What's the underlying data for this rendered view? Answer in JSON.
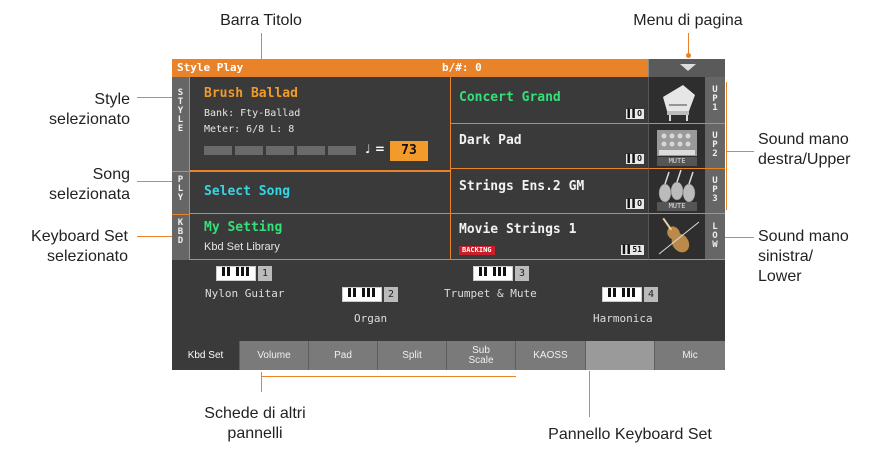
{
  "callouts": {
    "barra_titolo": "Barra Titolo",
    "menu_pagina": "Menu di pagina",
    "style_sel_1": "Style",
    "style_sel_2": "selezionato",
    "song_sel_1": "Song",
    "song_sel_2": "selezionata",
    "kbdset_sel_1": "Keyboard Set",
    "kbdset_sel_2": "selezionato",
    "upper_1": "Sound mano",
    "upper_2": "destra/Upper",
    "lower_1": "Sound mano",
    "lower_2": "sinistra/",
    "lower_3": "Lower",
    "schede_1": "Schede di altri",
    "schede_2": "pannelli",
    "pannello_kbd": "Pannello Keyboard Set"
  },
  "titlebar": {
    "mode": "Style Play",
    "key": "b/#: 0"
  },
  "side_tabs": {
    "style": [
      "S",
      "T",
      "Y",
      "L",
      "E"
    ],
    "play": [
      "P",
      "L",
      "Y"
    ],
    "kbd": [
      "K",
      "B",
      "D"
    ]
  },
  "style_panel": {
    "name": "Brush Ballad",
    "bank": "Bank: Fty-Ballad",
    "meter": "Meter: 6/8 L:  8",
    "tempo_symbol": "♩ =",
    "tempo": "73"
  },
  "song_panel": {
    "name": "Select Song"
  },
  "kbdset_panel": {
    "name": "My Setting",
    "library": "Kbd Set Library"
  },
  "sounds": [
    {
      "name": "Concert Grand",
      "mini": "▌▌O",
      "tab": [
        "U",
        "P",
        "1"
      ],
      "icon": "piano-icon",
      "mute": ""
    },
    {
      "name": "Dark Pad",
      "mini": "▌▌O",
      "tab": [
        "U",
        "P",
        "2"
      ],
      "icon": "synth-pad-icon",
      "mute": "MUTE"
    },
    {
      "name": "Strings Ens.2 GM",
      "mini": "▌▌O",
      "tab": [
        "U",
        "P",
        "3"
      ],
      "icon": "strings-icon",
      "mute": "MUTE"
    },
    {
      "name": "Movie Strings 1",
      "mini": "▌▌51",
      "tab": [
        "L",
        "O",
        "W"
      ],
      "icon": "violin-icon",
      "mute": "",
      "badge": "BACKING"
    }
  ],
  "keyboards": [
    {
      "num": "1",
      "name": "Nylon Guitar"
    },
    {
      "num": "2",
      "name": "Organ"
    },
    {
      "num": "3",
      "name": "Trumpet & Mute"
    },
    {
      "num": "4",
      "name": "Harmonica"
    }
  ],
  "tabs": [
    {
      "label": "Kbd Set",
      "active": true
    },
    {
      "label": "Volume"
    },
    {
      "label": "Pad"
    },
    {
      "label": "Split"
    },
    {
      "label": "Sub\nScale"
    },
    {
      "label": "KAOSS"
    },
    {
      "label": ""
    },
    {
      "label": "Mic"
    }
  ],
  "colors": {
    "accent": "#e8832a",
    "background": "#3a3a3a",
    "cyan": "#35d6e6",
    "green": "#33e07a"
  }
}
